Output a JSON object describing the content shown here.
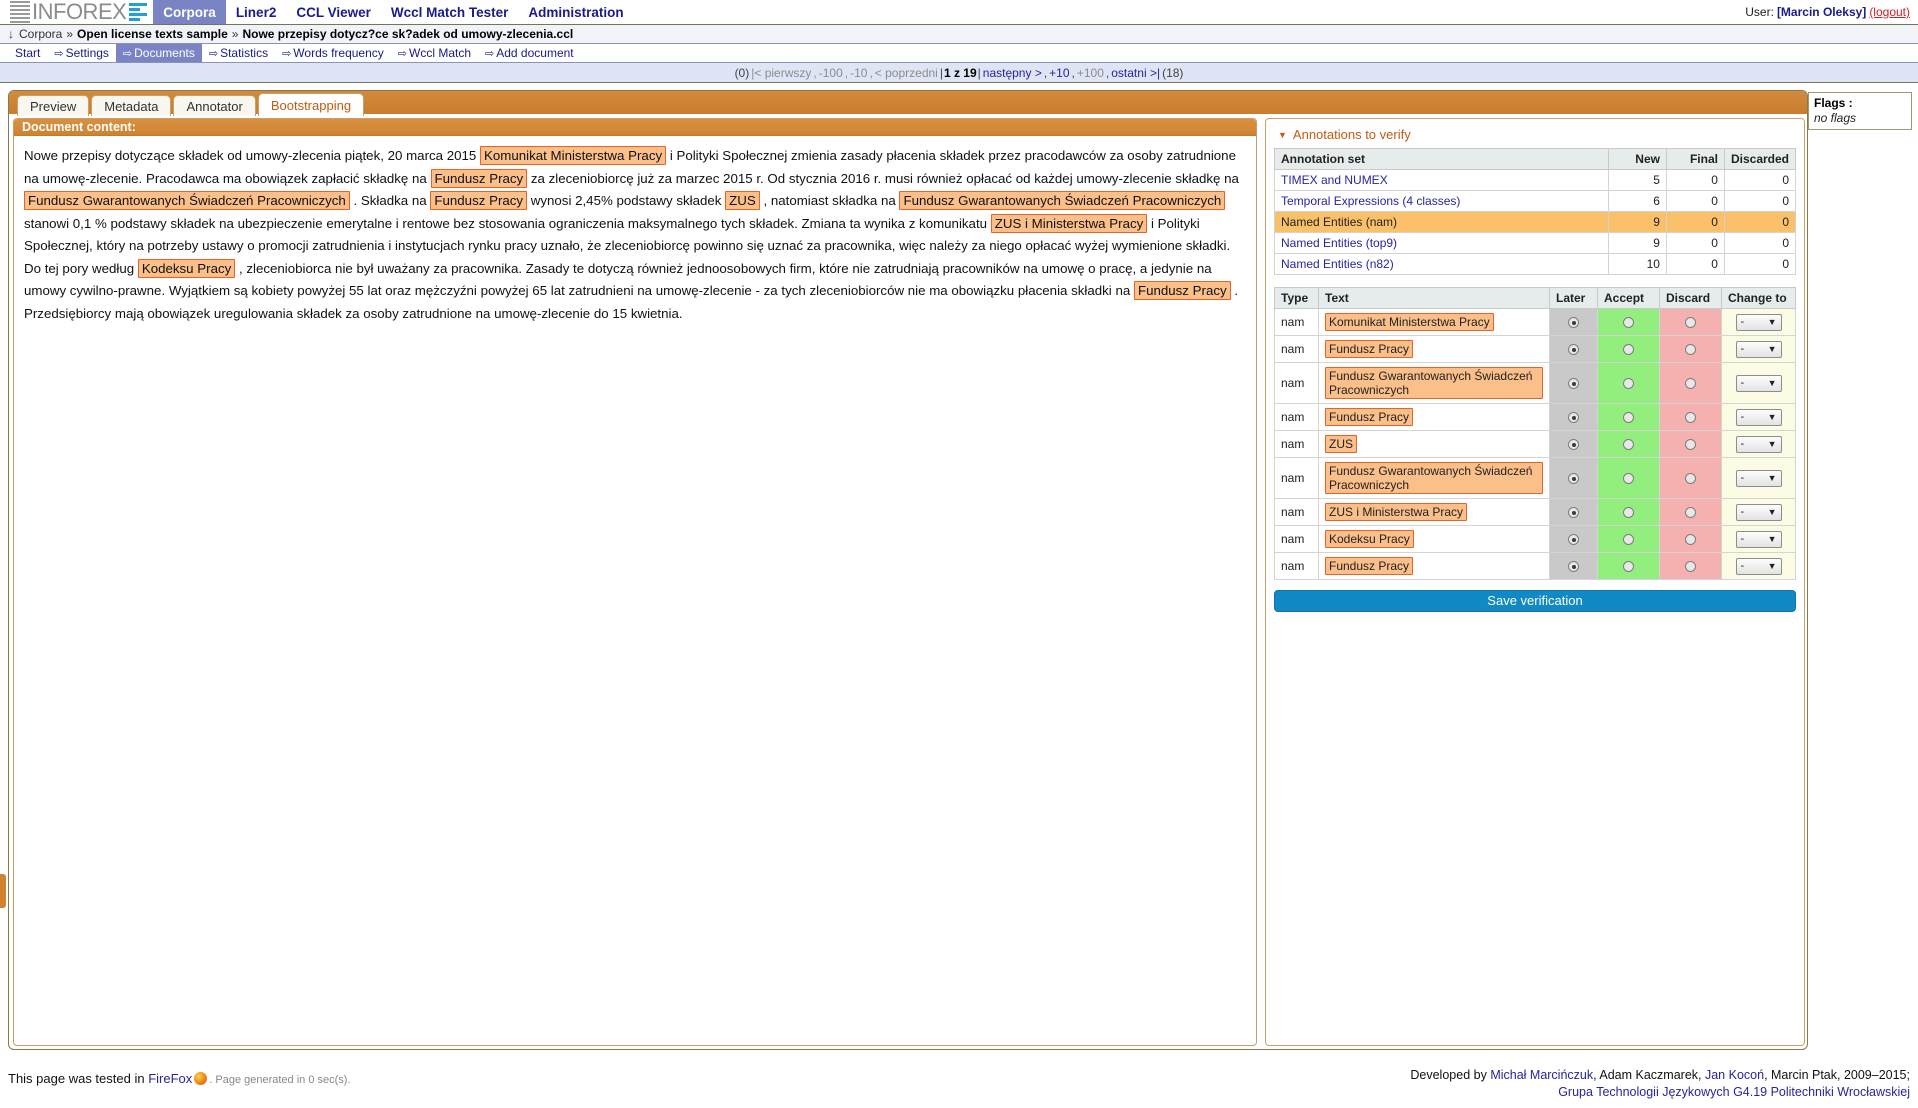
{
  "topnav": {
    "brand": "INFOREX",
    "items": [
      {
        "label": "Corpora",
        "active": true
      },
      {
        "label": "Liner2",
        "active": false
      },
      {
        "label": "CCL Viewer",
        "active": false
      },
      {
        "label": "Wccl Match Tester",
        "active": false
      },
      {
        "label": "Administration",
        "active": false
      }
    ],
    "user_label": "User:",
    "user_name": "[Marcin Oleksy]",
    "logout": "(logout)"
  },
  "breadcrumb": {
    "arrow": "↓",
    "root": "Corpora",
    "sep": "»",
    "corpus": "Open license texts sample",
    "document": "Nowe przepisy dotycz?ce sk?adek od umowy-zlecenia.ccl"
  },
  "subnav": {
    "items": [
      {
        "label": "Start",
        "glyph": "",
        "active": false
      },
      {
        "label": "Settings",
        "glyph": "⇨",
        "active": false
      },
      {
        "label": "Documents",
        "glyph": "⇨",
        "active": true
      },
      {
        "label": "Statistics",
        "glyph": "⇨",
        "active": false
      },
      {
        "label": "Words frequency",
        "glyph": "⇨",
        "active": false
      },
      {
        "label": "Wccl Match",
        "glyph": "⇨",
        "active": false
      },
      {
        "label": "Add document",
        "glyph": "⇨",
        "active": false
      }
    ]
  },
  "pagination": {
    "count_prefix": "(0)",
    "first": "|< pierwszy",
    "minus100": "-100",
    "minus10": "-10",
    "prev": "< poprzedni",
    "position": "1 z 19",
    "next": "następny >",
    "plus10": "+10",
    "plus100": "+100",
    "last": "ostatni >|",
    "total": "(18)",
    "sep": ",",
    "pipe": "|"
  },
  "flags": {
    "label": "Flags :",
    "value": "no flags"
  },
  "tabs": [
    {
      "label": "Preview",
      "active": false
    },
    {
      "label": "Metadata",
      "active": false
    },
    {
      "label": "Annotator",
      "active": false
    },
    {
      "label": "Bootstrapping",
      "active": true
    }
  ],
  "document": {
    "header": "Document content:",
    "segments": [
      {
        "t": "Nowe przepisy dotyczące składek od umowy-zlecenia piątek, 20 marca 2015 ",
        "a": false
      },
      {
        "t": "Komunikat Ministerstwa Pracy",
        "a": true
      },
      {
        "t": " i Polityki Społecznej zmienia zasady płacenia składek przez pracodawców za osoby zatrudnione na umowę-zlecenie. Pracodawca ma obowiązek zapłacić składkę na ",
        "a": false
      },
      {
        "t": "Fundusz Pracy",
        "a": true
      },
      {
        "t": " za zleceniobiorcę już za marzec 2015 r. Od stycznia 2016 r. musi również opłacać od każdej umowy-zlecenie składkę na ",
        "a": false
      },
      {
        "t": "Fundusz Gwarantowanych Świadczeń Pracowniczych",
        "a": true
      },
      {
        "t": " . Składka na ",
        "a": false
      },
      {
        "t": "Fundusz Pracy",
        "a": true
      },
      {
        "t": " wynosi 2,45% podstawy składek ",
        "a": false
      },
      {
        "t": "ZUS",
        "a": true
      },
      {
        "t": " , natomiast składka na ",
        "a": false
      },
      {
        "t": "Fundusz Gwarantowanych Świadczeń Pracowniczych",
        "a": true
      },
      {
        "t": " stanowi 0,1 % podstawy składek na ubezpieczenie emerytalne i rentowe bez stosowania ograniczenia maksymalnego tych składek. Zmiana ta wynika z komunikatu ",
        "a": false
      },
      {
        "t": "ZUS i Ministerstwa Pracy",
        "a": true
      },
      {
        "t": " i Polityki Społecznej, który na potrzeby ustawy o promocji zatrudnienia i instytucjach rynku pracy uznało, że zleceniobiorcę powinno się uznać za pracownika, więc należy za niego opłacać wyżej wymienione składki. Do tej pory według ",
        "a": false
      },
      {
        "t": "Kodeksu Pracy",
        "a": true
      },
      {
        "t": " , zleceniobiorca nie był uważany za pracownika. Zasady te dotyczą również jednoosobowych firm, które nie zatrudniają pracowników na umowę o pracę, a jedynie na umowy cywilno-prawne. Wyjątkiem są kobiety powyżej 55 lat oraz mężczyźni powyżej 65 lat zatrudnieni na umowę-zlecenie - za tych zleceniobiorców nie ma obowiązku płacenia składki na ",
        "a": false
      },
      {
        "t": "Fundusz Pracy",
        "a": true
      },
      {
        "t": " . Przedsiębiorcy mają obowiązek uregulowania składek za osoby zatrudnione na umowę-zlecenie do 15 kwietnia.",
        "a": false
      }
    ]
  },
  "annotations_panel": {
    "title": "Annotations to verify",
    "sets_table": {
      "headers": [
        "Annotation set",
        "New",
        "Final",
        "Discarded"
      ],
      "rows": [
        {
          "name": "TIMEX and NUMEX",
          "new": "5",
          "final": "0",
          "discarded": "0",
          "selected": false
        },
        {
          "name": "Temporal Expressions (4 classes)",
          "new": "6",
          "final": "0",
          "discarded": "0",
          "selected": false
        },
        {
          "name": "Named Entities (nam)",
          "new": "9",
          "final": "0",
          "discarded": "0",
          "selected": true
        },
        {
          "name": "Named Entities (top9)",
          "new": "9",
          "final": "0",
          "discarded": "0",
          "selected": false
        },
        {
          "name": "Named Entities (n82)",
          "new": "10",
          "final": "0",
          "discarded": "0",
          "selected": false
        }
      ]
    },
    "verify_table": {
      "headers": [
        "Type",
        "Text",
        "Later",
        "Accept",
        "Discard",
        "Change to"
      ],
      "change_to_value": "-",
      "rows": [
        {
          "type": "nam",
          "text": "Komunikat Ministerstwa Pracy",
          "later": true,
          "accept": false,
          "discard": false,
          "change_to": "-"
        },
        {
          "type": "nam",
          "text": "Fundusz Pracy",
          "later": true,
          "accept": false,
          "discard": false,
          "change_to": "-"
        },
        {
          "type": "nam",
          "text": "Fundusz Gwarantowanych Świadczeń Pracowniczych",
          "later": true,
          "accept": false,
          "discard": false,
          "change_to": "-"
        },
        {
          "type": "nam",
          "text": "Fundusz Pracy",
          "later": true,
          "accept": false,
          "discard": false,
          "change_to": "-"
        },
        {
          "type": "nam",
          "text": "ZUS",
          "later": true,
          "accept": false,
          "discard": false,
          "change_to": "-"
        },
        {
          "type": "nam",
          "text": "Fundusz Gwarantowanych Świadczeń Pracowniczych",
          "later": true,
          "accept": false,
          "discard": false,
          "change_to": "-"
        },
        {
          "type": "nam",
          "text": "ZUS i Ministerstwa Pracy",
          "later": true,
          "accept": false,
          "discard": false,
          "change_to": "-"
        },
        {
          "type": "nam",
          "text": "Kodeksu Pracy",
          "later": true,
          "accept": false,
          "discard": false,
          "change_to": "-"
        },
        {
          "type": "nam",
          "text": "Fundusz Pracy",
          "later": true,
          "accept": false,
          "discard": false,
          "change_to": "-"
        }
      ]
    },
    "save_button": "Save verification"
  },
  "footer": {
    "tested_prefix": "This page was tested in",
    "browser": "FireFox",
    "generated": ". Page generated in 0 sec(s).",
    "developed_prefix": "Developed by",
    "dev1": "Michał Marcińczuk",
    "dev2": ", Adam Kaczmarek, ",
    "dev3": "Jan Kocoń",
    "dev4": ", Marcin Ptak, 2009–2015;",
    "group": "Grupa Technologii Językowych G4.19 Politechniki Wrocławskiej"
  },
  "colors": {
    "accent_orange": "#c05d12",
    "nav_active": "#7a84c4",
    "annotation_bg": "#fbbf8a",
    "annotation_border": "#e8622a",
    "row_selected": "#fbc06a",
    "accept_green": "#92ef7e",
    "discard_red": "#f5b0b0",
    "save_blue": "#1189c4"
  }
}
